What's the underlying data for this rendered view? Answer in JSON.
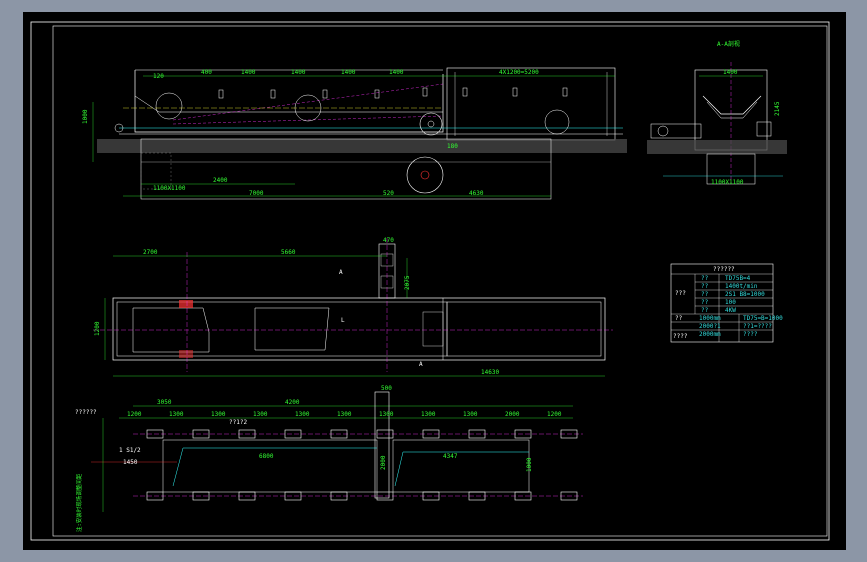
{
  "drawing": {
    "section_title": "A-A剖视",
    "section_marker": "A",
    "l_marker": "L",
    "side_dims": {
      "d120": "120",
      "d400": "400",
      "d1400a": "1400",
      "d1400b": "1400",
      "d1400c": "1400",
      "d1400d": "1400",
      "pitch": "4X1200=5200",
      "d2400": "2400",
      "d7000": "7000",
      "d520": "520",
      "d4630": "4630",
      "d180": "180",
      "d1100": "1100X1100",
      "d1000": "1000"
    },
    "front_dims": {
      "d1400": "1400",
      "d2145": "2145",
      "d1100": "1100X1100"
    },
    "plan_dims": {
      "d2700": "2700",
      "d5660": "5660",
      "d470": "470",
      "d2075": "2075",
      "d1200": "1200",
      "d14630": "14630"
    },
    "bottom_dims": {
      "d3050": "3050",
      "d4200": "4200",
      "d500": "500",
      "label1": "??????",
      "label2": "1 S1/2",
      "label3": "1450",
      "label4": "??1?2",
      "d6800": "6800",
      "d4347": "4347",
      "d2000": "2000",
      "d1000": "1000",
      "spacings": [
        "1200",
        "1300",
        "1300",
        "1300",
        "1300",
        "1300",
        "1300",
        "1300",
        "1300",
        "2000",
        "1200"
      ],
      "vertical_note": "注:安装时现场调整间距"
    },
    "spec_table": {
      "title": "??????",
      "rows": [
        [
          "??",
          "TD75B=4"
        ],
        [
          "??",
          "1400t/min"
        ],
        [
          "??",
          "2S1 B8=1000"
        ],
        [
          "??",
          "100"
        ],
        [
          "??",
          "4KW"
        ],
        [
          "1000mm",
          "TD75=B=1000"
        ],
        [
          "2000?1",
          "??1=????"
        ],
        [
          "2000mm",
          "????"
        ]
      ],
      "side_label_1": "???",
      "side_label_2": "??",
      "side_label_3": "????"
    }
  }
}
